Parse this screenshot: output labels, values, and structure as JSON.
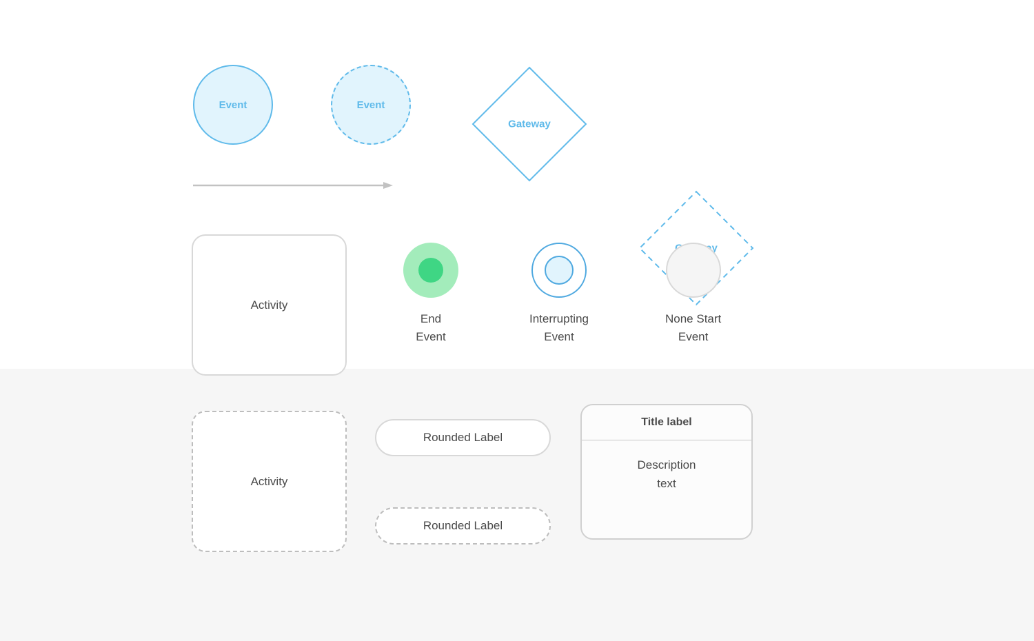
{
  "shapes": {
    "event_solid": {
      "label": "Event"
    },
    "event_dashed": {
      "label": "Event"
    },
    "gateway_solid": {
      "label": "Gateway"
    },
    "gateway_dashed": {
      "label": "Gateway"
    },
    "activity_solid": {
      "label": "Activity"
    },
    "activity_dashed": {
      "label": "Activity"
    },
    "end_event": {
      "label": "End\nEvent"
    },
    "interrupting_event": {
      "label": "Interrupting\nEvent"
    },
    "none_start_event": {
      "label": "None Start\nEvent"
    },
    "rounded_solid": {
      "label": "Rounded Label"
    },
    "rounded_dashed": {
      "label": "Rounded Label"
    },
    "card": {
      "title": "Title label",
      "description": "Description\ntext"
    }
  },
  "colors": {
    "accent_blue": "#5fbaea",
    "light_blue_fill": "#e1f4fd",
    "green_light": "#a3ecbb",
    "green_dark": "#3fd684",
    "border_gray": "#d8d8d8",
    "border_dashed_gray": "#bdbdbd",
    "text": "#4a4a4a",
    "panel_bg": "#f6f6f6"
  }
}
